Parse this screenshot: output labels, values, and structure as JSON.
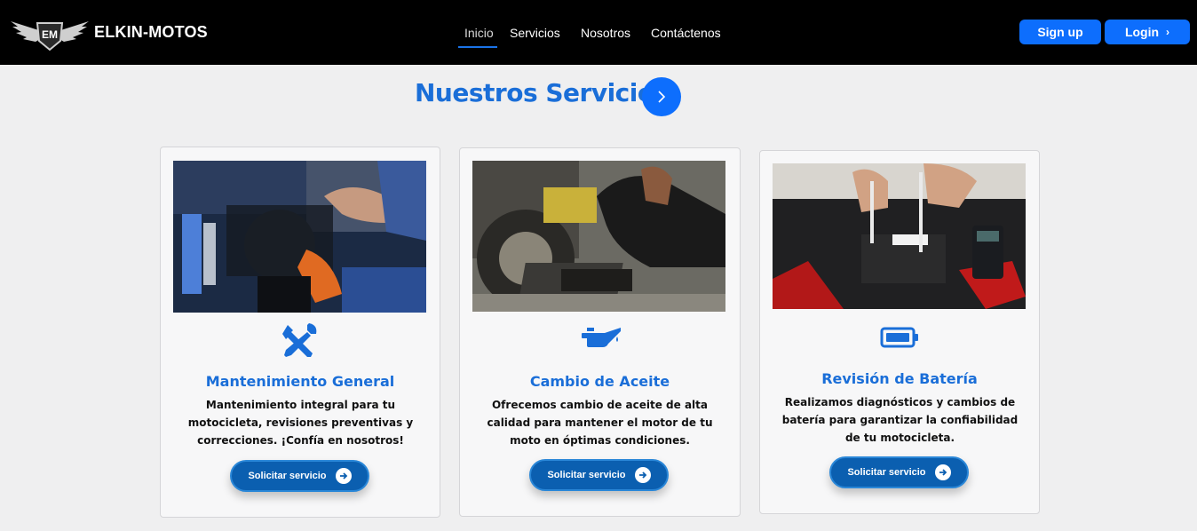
{
  "navbar": {
    "brand": "ELKIN-MOTOS",
    "logo_text": "EM",
    "links": [
      "Inicio",
      "Servicios",
      "Nosotros",
      "Contáctenos"
    ],
    "active_link": "Inicio",
    "signup_label": "Sign up",
    "login_label": "Login"
  },
  "header": {
    "title": "Nuestros Servicios"
  },
  "services": [
    {
      "title": "Mantenimiento General",
      "icon": "tools-icon",
      "description": "Mantenimiento integral para tu motocicleta, revisiones preventivas y correcciones. ¡Confía en nosotros!",
      "button": "Solicitar servicio"
    },
    {
      "title": "Cambio de Aceite",
      "icon": "oil-can-icon",
      "description": "Ofrecemos cambio de aceite de alta calidad para mantener el motor de tu moto en óptimas condiciones.",
      "button": "Solicitar servicio"
    },
    {
      "title": "Revisión de Batería",
      "icon": "battery-icon",
      "description": "Realizamos diagnósticos y cambios de batería para garantizar la confiabilidad de tu motocicleta.",
      "button": "Solicitar servicio"
    }
  ],
  "colors": {
    "accent": "#0d6efd",
    "title_blue": "#1a6ed8",
    "button_blue": "#0b5fb0",
    "navbar_bg": "#000000",
    "page_bg": "#efeff0"
  }
}
